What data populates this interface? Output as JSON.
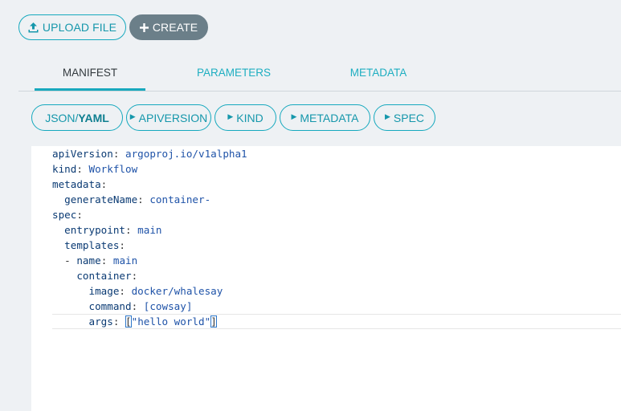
{
  "toolbar": {
    "upload_label": "UPLOAD FILE",
    "create_label": "CREATE"
  },
  "tabs": [
    {
      "label": "MANIFEST",
      "active": true
    },
    {
      "label": "PARAMETERS",
      "active": false
    },
    {
      "label": "METADATA",
      "active": false
    }
  ],
  "pills": {
    "json_prefix": "JSON/",
    "json_bold": "YAML",
    "apiversion": "APIVERSION",
    "kind": "KIND",
    "metadata": "METADATA",
    "spec": "SPEC"
  },
  "editor": {
    "l1": {
      "key": "apiVersion",
      "val": "argoproj.io/v1alpha1"
    },
    "l2": {
      "key": "kind",
      "val": "Workflow"
    },
    "l3": {
      "key": "metadata"
    },
    "l4": {
      "indent": "  ",
      "key": "generateName",
      "val": "container-"
    },
    "l5": {
      "key": "spec"
    },
    "l6": {
      "indent": "  ",
      "key": "entrypoint",
      "val": "main"
    },
    "l7": {
      "indent": "  ",
      "key": "templates"
    },
    "l8": {
      "indent": "  ",
      "dash": "- ",
      "key": "name",
      "val": "main"
    },
    "l9": {
      "indent": "    ",
      "key": "container"
    },
    "l10": {
      "indent": "      ",
      "key": "image",
      "val": "docker/whalesay"
    },
    "l11": {
      "indent": "      ",
      "key": "command",
      "val": "[cowsay]"
    },
    "l12": {
      "indent": "      ",
      "key": "args",
      "open": "[",
      "val": "\"hello world\"",
      "close": "]"
    }
  },
  "colors": {
    "accent": "#16a9be",
    "create_bg": "#6b7f89",
    "page_bg": "#eef1f4"
  }
}
